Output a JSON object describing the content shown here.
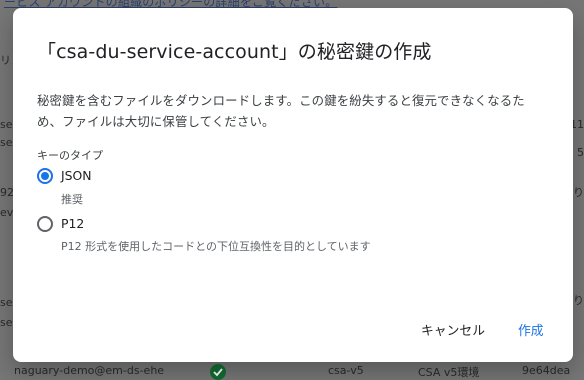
{
  "background": {
    "top_link": "ービス アカウントの組織のポリシーの詳細をご覧ください。",
    "left_fragments": [
      "リン",
      "ser",
      "se",
      "92",
      "eve",
      "serv",
      "se"
    ],
    "right_fragments": [
      "11",
      "5",
      "り",
      "り"
    ],
    "bottom_email": "naguary-demo@em-ds-ehe",
    "bottom_name": "csa-v5",
    "bottom_desc": "CSA v5環境",
    "bottom_id": "9e64dea"
  },
  "dialog": {
    "title": "「csa-du-service-account」の秘密鍵の作成",
    "description": "秘密鍵を含むファイルをダウンロードします。この鍵を紛失すると復元できなくなるため、ファイルは大切に保管してください。",
    "key_type_label": "キーのタイプ",
    "options": [
      {
        "label": "JSON",
        "sub": "推奨",
        "selected": true
      },
      {
        "label": "P12",
        "sub": "P12 形式を使用したコードとの下位互換性を目的としています",
        "selected": false
      }
    ],
    "cancel_label": "キャンセル",
    "create_label": "作成"
  },
  "colors": {
    "accent": "#1a73e8",
    "overlay": "#767676"
  },
  "icons": {
    "background_status": "check-circle-icon"
  }
}
